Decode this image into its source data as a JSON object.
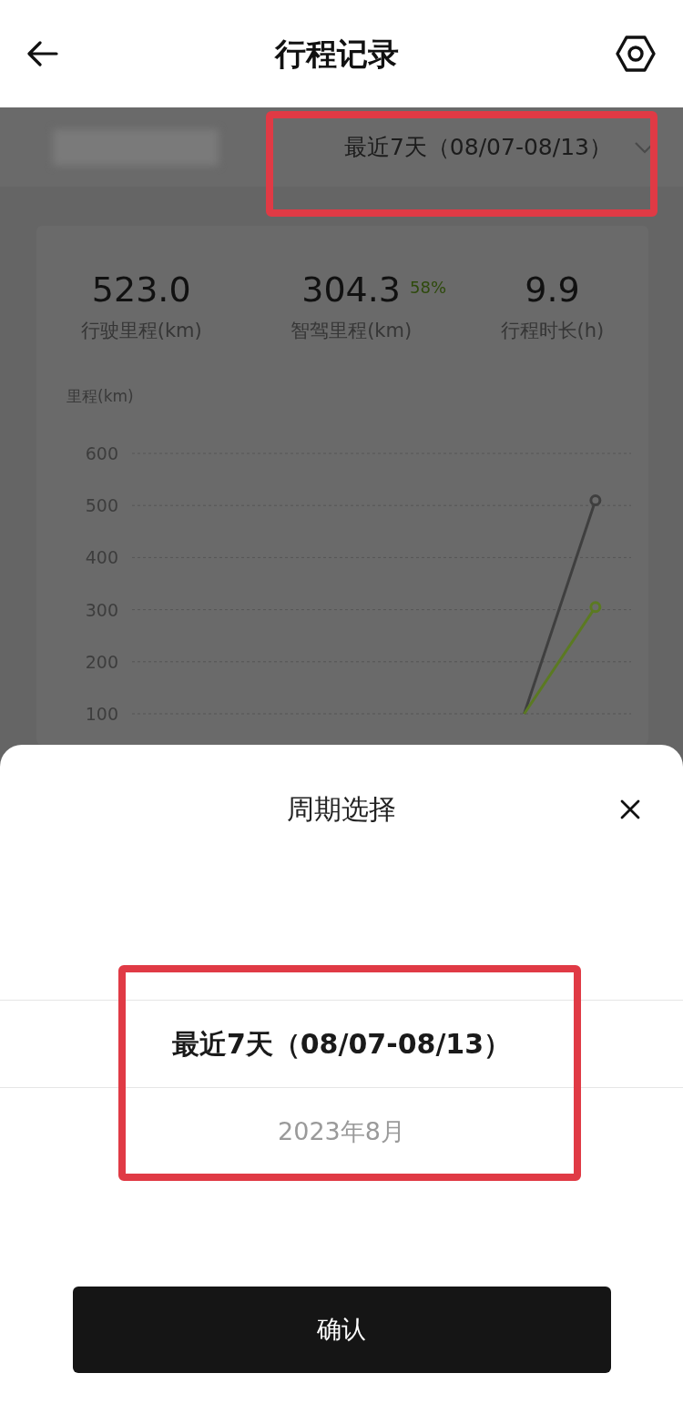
{
  "header": {
    "title": "行程记录"
  },
  "filter": {
    "period": "最近7天（08/07-08/13）",
    "highlighted": true
  },
  "stats": [
    {
      "value": "523.0",
      "label": "行驶里程(km)"
    },
    {
      "value": "304.3",
      "share": "58%",
      "label": "智驾里程(km)"
    },
    {
      "value": "9.9",
      "label": "行程时长(h)"
    }
  ],
  "chart": {
    "chart_data": {
      "type": "line",
      "ylabel": "里程(km)",
      "grid": true,
      "categories": [
        null,
        null,
        null,
        null,
        null,
        null,
        null
      ],
      "ylim": [
        100,
        600
      ],
      "yticks": [
        100,
        200,
        300,
        400,
        500,
        600
      ],
      "series": [
        {
          "color": "#3f3f3f",
          "values": [
            null,
            null,
            null,
            null,
            null,
            100,
            510
          ]
        },
        {
          "color": "#5b7a22",
          "values": [
            null,
            null,
            null,
            null,
            null,
            100,
            305
          ]
        }
      ]
    }
  },
  "sheet": {
    "title": "周期选择",
    "highlighted": true,
    "options": [
      {
        "label": "最近7天（08/07-08/13）",
        "selected": true
      },
      {
        "label": "2023年8月",
        "selected": false
      }
    ],
    "confirm": "确认"
  }
}
